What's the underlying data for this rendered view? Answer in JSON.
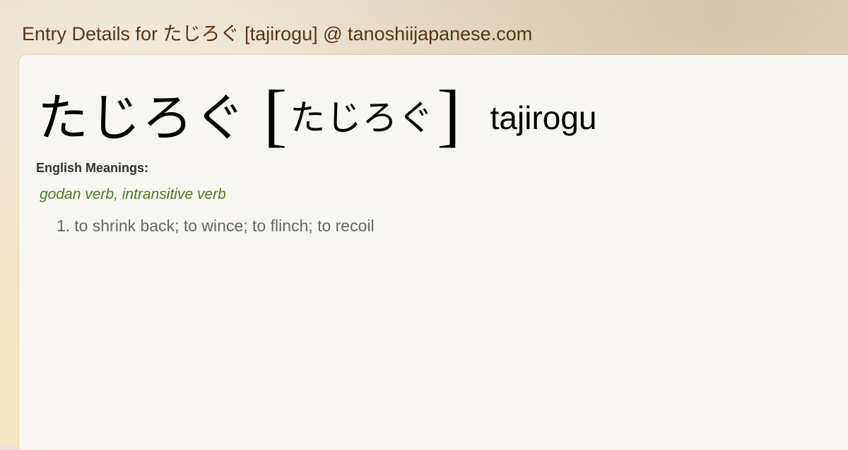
{
  "site_title": "Entry Details for たじろぐ [tajirogu] @ tanoshiijapanese.com",
  "entry": {
    "kanji": "たじろぐ",
    "bracket_open": "[",
    "kana": "たじろぐ",
    "bracket_close": "]",
    "romaji": "tajirogu"
  },
  "meanings_label": "English Meanings:",
  "part_of_speech": "godan verb, intransitive verb",
  "definitions": [
    {
      "number": "1.",
      "text": "to shrink back; to wince; to flinch; to recoil"
    }
  ],
  "colors": {
    "title": "#5a3512",
    "part_of_speech": "#4f7a1e",
    "definition_text": "#666666",
    "card_background": "#f7f6f3"
  }
}
